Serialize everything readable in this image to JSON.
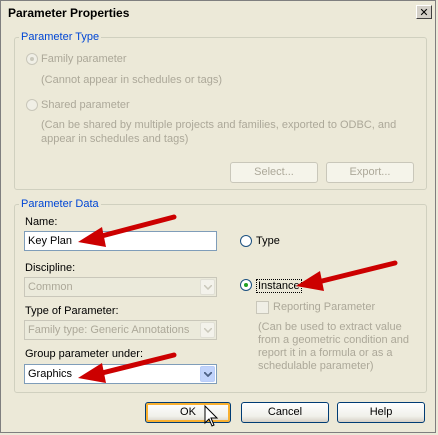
{
  "window": {
    "title": "Parameter Properties",
    "close_glyph": "✕"
  },
  "parameter_type": {
    "legend": "Parameter Type",
    "family_label": "Family parameter",
    "family_note": "(Cannot appear in schedules or tags)",
    "shared_label": "Shared parameter",
    "shared_note_1": "(Can be shared by multiple projects and families, exported to ODBC, and",
    "shared_note_2": "appear in schedules and tags)",
    "select_button": "Select...",
    "export_button": "Export..."
  },
  "parameter_data": {
    "legend": "Parameter Data",
    "name_label": "Name:",
    "name_value": "Key Plan",
    "discipline_label": "Discipline:",
    "discipline_value": "Common",
    "type_label": "Type of Parameter:",
    "type_value": "Family type: Generic Annotations",
    "group_label": "Group parameter under:",
    "group_value": "Graphics",
    "type_radio": "Type",
    "instance_radio": "Instance",
    "reporting_label": "Reporting Parameter",
    "reporting_note_1": "(Can be used to extract value",
    "reporting_note_2": "from a geometric condition and",
    "reporting_note_3": "report it in a formula or as a",
    "reporting_note_4": "schedulable parameter)"
  },
  "footer": {
    "ok": "OK",
    "cancel": "Cancel",
    "help": "Help"
  },
  "colors": {
    "annotation_arrow": "#cc0000",
    "legend": "#0046d5"
  },
  "icons": [
    "close-icon",
    "dropdown-arrow-icon",
    "mouse-cursor-icon",
    "annotation-arrow-icon"
  ]
}
